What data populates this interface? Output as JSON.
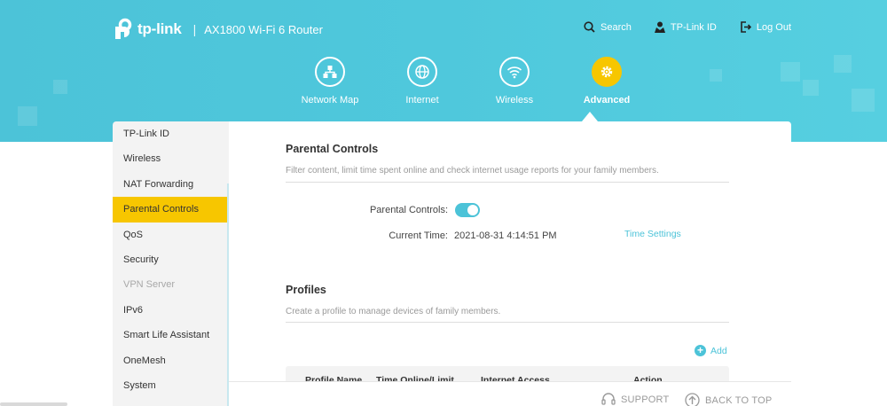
{
  "header": {
    "brand": "tp-link",
    "separator": "|",
    "model": "AX1800 Wi-Fi 6 Router",
    "links": [
      {
        "label": "Search",
        "icon": "search-icon"
      },
      {
        "label": "TP-Link ID",
        "icon": "user-icon"
      },
      {
        "label": "Log Out",
        "icon": "logout-icon"
      }
    ]
  },
  "main_nav": {
    "tabs": [
      {
        "label": "Network Map",
        "icon": "network-map-icon",
        "active": false
      },
      {
        "label": "Internet",
        "icon": "globe-icon",
        "active": false
      },
      {
        "label": "Wireless",
        "icon": "wifi-icon",
        "active": false
      },
      {
        "label": "Advanced",
        "icon": "gear-icon",
        "active": true
      }
    ]
  },
  "sidebar": {
    "items": [
      {
        "label": "TP-Link ID"
      },
      {
        "label": "Wireless"
      },
      {
        "label": "NAT Forwarding"
      },
      {
        "label": "Parental Controls",
        "active": true
      },
      {
        "label": "QoS"
      },
      {
        "label": "Security"
      },
      {
        "label": "VPN Server",
        "disabled": true
      },
      {
        "label": "IPv6"
      },
      {
        "label": "Smart Life Assistant"
      },
      {
        "label": "OneMesh"
      },
      {
        "label": "System"
      }
    ]
  },
  "parental": {
    "title": "Parental Controls",
    "description": "Filter content, limit time spent online and check internet usage reports for your family members.",
    "toggle_label": "Parental Controls:",
    "toggle_on": true,
    "time_label": "Current Time:",
    "time_value": "2021-08-31 4:14:51 PM",
    "time_settings_link": "Time Settings"
  },
  "profiles": {
    "title": "Profiles",
    "description": "Create a profile to manage devices of family members.",
    "add_label": "Add",
    "columns": [
      "Profile Name",
      "Time Online/Limit",
      "Internet Access",
      "Action"
    ]
  },
  "footer": {
    "support": "SUPPORT",
    "back_to_top": "BACK TO TOP"
  },
  "colors": {
    "accent": "#4cc3d8",
    "active": "#f7c600"
  }
}
